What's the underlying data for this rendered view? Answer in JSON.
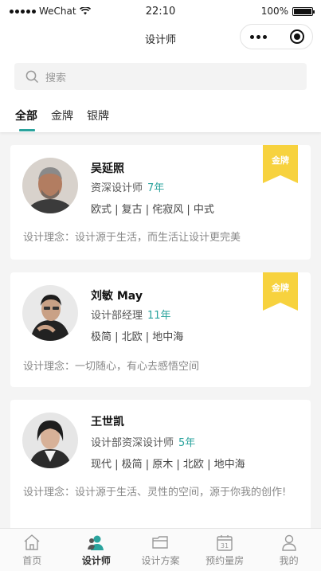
{
  "status_bar": {
    "carrier": "WeChat",
    "time": "22:10",
    "battery": "100%"
  },
  "navbar": {
    "title": "设计师"
  },
  "search": {
    "placeholder": "搜索"
  },
  "tabs": [
    {
      "label": "全部",
      "active": true
    },
    {
      "label": "金牌",
      "active": false
    },
    {
      "label": "银牌",
      "active": false
    }
  ],
  "designers": [
    {
      "name": "吴延照",
      "role": "资深设计师",
      "years": "7年",
      "styles": "欧式 | 复古 | 侘寂风 | 中式",
      "philosophy": "设计理念：设计源于生活，而生活让设计更完美",
      "badge": "金牌"
    },
    {
      "name": "刘敏 May",
      "role": "设计部经理",
      "years": "11年",
      "styles": "极简 | 北欧 | 地中海",
      "philosophy": "设计理念：一切随心，有心去感悟空间",
      "badge": "金牌"
    },
    {
      "name": "王世凯",
      "role": "设计部资深设计师",
      "years": "5年",
      "styles": "现代 | 极简 | 原木 | 北欧 | 地中海",
      "philosophy": "设计理念：设计源于生活、灵性的空间，源于你我的创作!",
      "badge": ""
    }
  ],
  "tabbar": [
    {
      "label": "首页",
      "icon": "home-icon",
      "active": false
    },
    {
      "label": "设计师",
      "icon": "designer-icon",
      "active": true
    },
    {
      "label": "设计方案",
      "icon": "folder-icon",
      "active": false
    },
    {
      "label": "预约量房",
      "icon": "calendar-icon",
      "active": false
    },
    {
      "label": "我的",
      "icon": "profile-icon",
      "active": false
    }
  ],
  "calendar_day": "31",
  "colors": {
    "accent": "#2aa39d",
    "badge": "#f7d23e"
  }
}
